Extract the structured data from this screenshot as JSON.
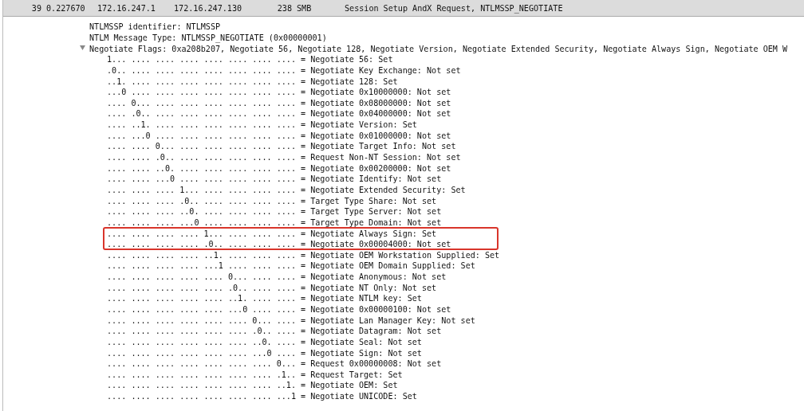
{
  "packet_row": {
    "selected": true,
    "cells": [
      "39",
      "0.227670",
      "172.16.247.1",
      "172.16.247.130",
      "238",
      "SMB",
      "Session Setup AndX Request, NTLMSSP_NEGOTIATE"
    ]
  },
  "details": [
    {
      "text": "NTLMSSP identifier: NTLMSSP"
    },
    {
      "text": "NTLM Message Type: NTLMSSP_NEGOTIATE (0x00000001)"
    },
    {
      "text": "Negotiate Flags: 0xa208b207, Negotiate 56, Negotiate 128, Negotiate Version, Negotiate Extended Security, Negotiate Always Sign, Negotiate OEM W",
      "expanded": true,
      "children": [
        {
          "bits": "1... .... .... .... .... .... .... ....",
          "label": "= Negotiate 56: Set",
          "boxed": false
        },
        {
          "bits": ".0.. .... .... .... .... .... .... ....",
          "label": "= Negotiate Key Exchange: Not set",
          "boxed": false
        },
        {
          "bits": "..1. .... .... .... .... .... .... ....",
          "label": "= Negotiate 128: Set",
          "boxed": false
        },
        {
          "bits": "...0 .... .... .... .... .... .... ....",
          "label": "= Negotiate 0x10000000: Not set",
          "boxed": false
        },
        {
          "bits": ".... 0... .... .... .... .... .... ....",
          "label": "= Negotiate 0x08000000: Not set",
          "boxed": false
        },
        {
          "bits": ".... .0.. .... .... .... .... .... ....",
          "label": "= Negotiate 0x04000000: Not set",
          "boxed": false
        },
        {
          "bits": ".... ..1. .... .... .... .... .... ....",
          "label": "= Negotiate Version: Set",
          "boxed": false
        },
        {
          "bits": ".... ...0 .... .... .... .... .... ....",
          "label": "= Negotiate 0x01000000: Not set",
          "boxed": false
        },
        {
          "bits": ".... .... 0... .... .... .... .... ....",
          "label": "= Negotiate Target Info: Not set",
          "boxed": false
        },
        {
          "bits": ".... .... .0.. .... .... .... .... ....",
          "label": "= Request Non-NT Session: Not set",
          "boxed": false
        },
        {
          "bits": ".... .... ..0. .... .... .... .... ....",
          "label": "= Negotiate 0x00200000: Not set",
          "boxed": false
        },
        {
          "bits": ".... .... ...0 .... .... .... .... ....",
          "label": "= Negotiate Identify: Not set",
          "boxed": false
        },
        {
          "bits": ".... .... .... 1... .... .... .... ....",
          "label": "= Negotiate Extended Security: Set",
          "boxed": false
        },
        {
          "bits": ".... .... .... .0.. .... .... .... ....",
          "label": "= Target Type Share: Not set",
          "boxed": false
        },
        {
          "bits": ".... .... .... ..0. .... .... .... ....",
          "label": "= Target Type Server: Not set",
          "boxed": false
        },
        {
          "bits": ".... .... .... ...0 .... .... .... ....",
          "label": "= Target Type Domain: Not set",
          "boxed": false
        },
        {
          "bits": ".... .... .... .... 1... .... .... ....",
          "label": "= Negotiate Always Sign: Set",
          "boxed": true
        },
        {
          "bits": ".... .... .... .... .0.. .... .... ....",
          "label": "= Negotiate 0x00004000: Not set",
          "boxed": true
        },
        {
          "bits": ".... .... .... .... ..1. .... .... ....",
          "label": "= Negotiate OEM Workstation Supplied: Set",
          "boxed": false
        },
        {
          "bits": ".... .... .... .... ...1 .... .... ....",
          "label": "= Negotiate OEM Domain Supplied: Set",
          "boxed": false
        },
        {
          "bits": ".... .... .... .... .... 0... .... ....",
          "label": "= Negotiate Anonymous: Not set",
          "boxed": false
        },
        {
          "bits": ".... .... .... .... .... .0.. .... ....",
          "label": "= Negotiate NT Only: Not set",
          "boxed": false
        },
        {
          "bits": ".... .... .... .... .... ..1. .... ....",
          "label": "= Negotiate NTLM key: Set",
          "boxed": false
        },
        {
          "bits": ".... .... .... .... .... ...0 .... ....",
          "label": "= Negotiate 0x00000100: Not set",
          "boxed": false
        },
        {
          "bits": ".... .... .... .... .... .... 0... ....",
          "label": "= Negotiate Lan Manager Key: Not set",
          "boxed": false
        },
        {
          "bits": ".... .... .... .... .... .... .0.. ....",
          "label": "= Negotiate Datagram: Not set",
          "boxed": false
        },
        {
          "bits": ".... .... .... .... .... .... ..0. ....",
          "label": "= Negotiate Seal: Not set",
          "boxed": false
        },
        {
          "bits": ".... .... .... .... .... .... ...0 ....",
          "label": "= Negotiate Sign: Not set",
          "boxed": false
        },
        {
          "bits": ".... .... .... .... .... .... .... 0...",
          "label": "= Request 0x00000008: Not set",
          "boxed": false
        },
        {
          "bits": ".... .... .... .... .... .... .... .1..",
          "label": "= Request Target: Set",
          "boxed": false
        },
        {
          "bits": ".... .... .... .... .... .... .... ..1.",
          "label": "= Negotiate OEM: Set",
          "boxed": false
        },
        {
          "bits": ".... .... .... .... .... .... .... ...1",
          "label": "= Negotiate UNICODE: Set",
          "boxed": false
        }
      ]
    }
  ]
}
